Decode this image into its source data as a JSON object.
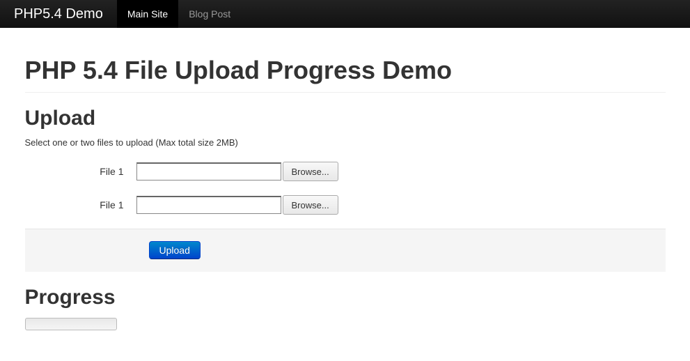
{
  "navbar": {
    "brand": "PHP5.4 Demo",
    "items": [
      {
        "label": "Main Site",
        "active": true
      },
      {
        "label": "Blog Post",
        "active": false
      }
    ]
  },
  "page": {
    "title": "PHP 5.4 File Upload Progress Demo"
  },
  "upload": {
    "heading": "Upload",
    "help": "Select one or two files to upload (Max total size 2MB)",
    "fields": [
      {
        "label": "File 1",
        "value": "",
        "browse": "Browse..."
      },
      {
        "label": "File 1",
        "value": "",
        "browse": "Browse..."
      }
    ],
    "submit": "Upload"
  },
  "progress": {
    "heading": "Progress",
    "percent": 0
  }
}
